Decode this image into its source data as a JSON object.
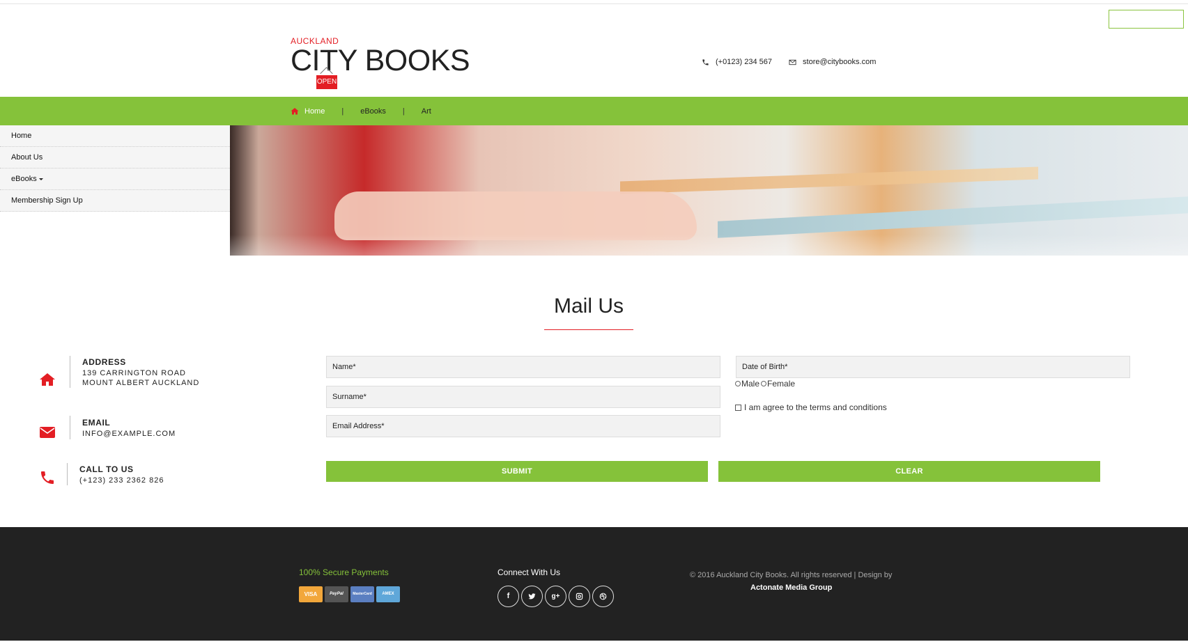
{
  "header": {
    "logo_small": "AUCKLAND",
    "logo_big": "CITY BOOKS",
    "logo_sign": "OPEN",
    "phone": "(+0123) 234 567",
    "email": "store@citybooks.com"
  },
  "nav": {
    "items": [
      {
        "label": "Home",
        "icon": "home-icon"
      },
      {
        "label": "eBooks"
      },
      {
        "label": "Art"
      }
    ],
    "separator": "|"
  },
  "sidemenu": {
    "items": [
      {
        "label": "Home"
      },
      {
        "label": "About Us"
      },
      {
        "label": "eBooks"
      },
      {
        "label": "Membership Sign Up"
      }
    ]
  },
  "mail": {
    "title": "Mail Us"
  },
  "contact_info": {
    "address": {
      "heading": "ADDRESS",
      "line1": "139 CARRINGTON ROAD",
      "line2": "MOUNT ALBERT AUCKLAND"
    },
    "email": {
      "heading": "EMAIL",
      "line1": "INFO@EXAMPLE.COM"
    },
    "call": {
      "heading": "CALL TO US",
      "line1": "(+123) 233 2362 826"
    }
  },
  "form": {
    "name_placeholder": "Name*",
    "surname_placeholder": "Surname*",
    "email_placeholder": "Email Address*",
    "dob_placeholder": "Date of Birth*",
    "gender_male": "Male",
    "gender_female": "Female",
    "agree_label": "I am agree to the terms and conditions",
    "submit_label": "SUBMIT",
    "clear_label": "CLEAR"
  },
  "footer": {
    "payments_title": "100% Secure Payments",
    "cards": [
      "VISA",
      "PayPal",
      "MasterCard",
      "AMEX"
    ],
    "connect_title": "Connect With Us",
    "socials": [
      "facebook-icon",
      "twitter-icon",
      "google-plus-icon",
      "instagram-icon",
      "dribbble-icon"
    ],
    "copyright": "© 2016 Auckland City Books. All rights reserved | Design by",
    "designer": "Actonate Media Group"
  },
  "colors": {
    "accent_green": "#85c23a",
    "accent_red": "#e31e24",
    "footer_bg": "#222222"
  }
}
